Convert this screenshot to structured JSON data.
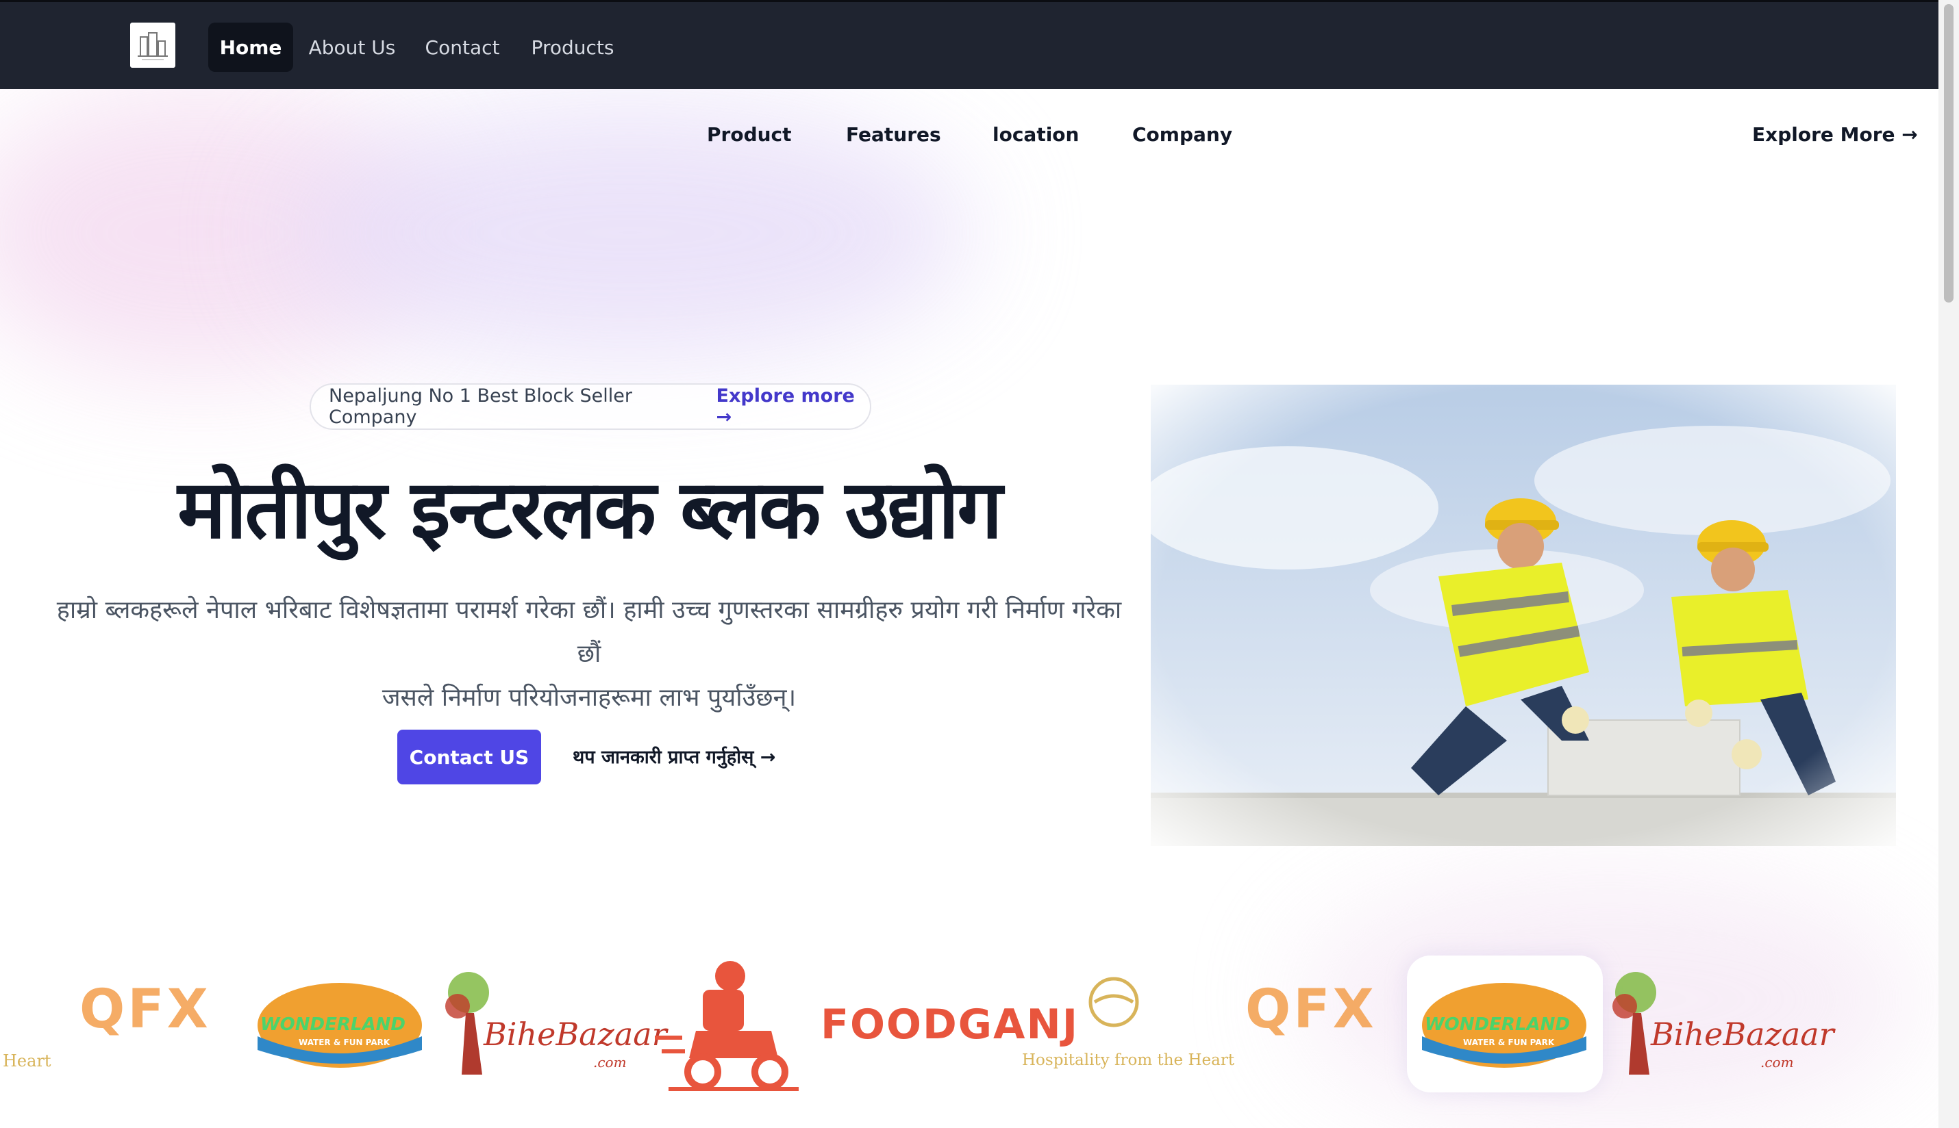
{
  "topnav": {
    "logo_icon": "building-logo-icon",
    "items": [
      {
        "label": "Home",
        "active": true
      },
      {
        "label": "About Us",
        "active": false
      },
      {
        "label": "Contact",
        "active": false
      },
      {
        "label": "Products",
        "active": false
      }
    ]
  },
  "subnav": {
    "items": [
      "Product",
      "Features",
      "location",
      "Company"
    ],
    "cta": "Explore More →"
  },
  "hero": {
    "badge_text": "Nepaljung No 1 Best Block Seller Company",
    "badge_link": "Explore more →",
    "title": "मोतीपुर इन्टरलक ब्लक उद्योग",
    "description_line1": "हाम्रो ब्लकहरूले नेपाल भरिबाट विशेषज्ञतामा परामर्श गरेका छौं। हामी उच्च गुणस्तरका सामग्रीहरु प्रयोग गरी निर्माण गरेका छौं",
    "description_line2": "जसले निर्माण परियोजनाहरूमा लाभ पुर्याउँछन्।",
    "primary_button": "Contact US",
    "secondary_link": "थप जानकारी प्राप्त गर्नुहोस् →",
    "image": "construction-workers-laying-blocks"
  },
  "partners": {
    "items": [
      "Heart",
      "QFX",
      "WONDERLAND",
      "WATER & FUN PARK",
      "BiheBazaar",
      ".com",
      "FOODGANJ",
      "Hospitality from the Heart",
      "QFX",
      "WONDERLAND",
      "WATER & FUN PARK",
      "BiheBazaar",
      ".com"
    ]
  },
  "colors": {
    "topbar": "#1f2430",
    "accent": "#4f46e5",
    "accent_text": "#4338ca",
    "foodganj": "#e8553d",
    "wonderland_orange": "#f0a030"
  }
}
